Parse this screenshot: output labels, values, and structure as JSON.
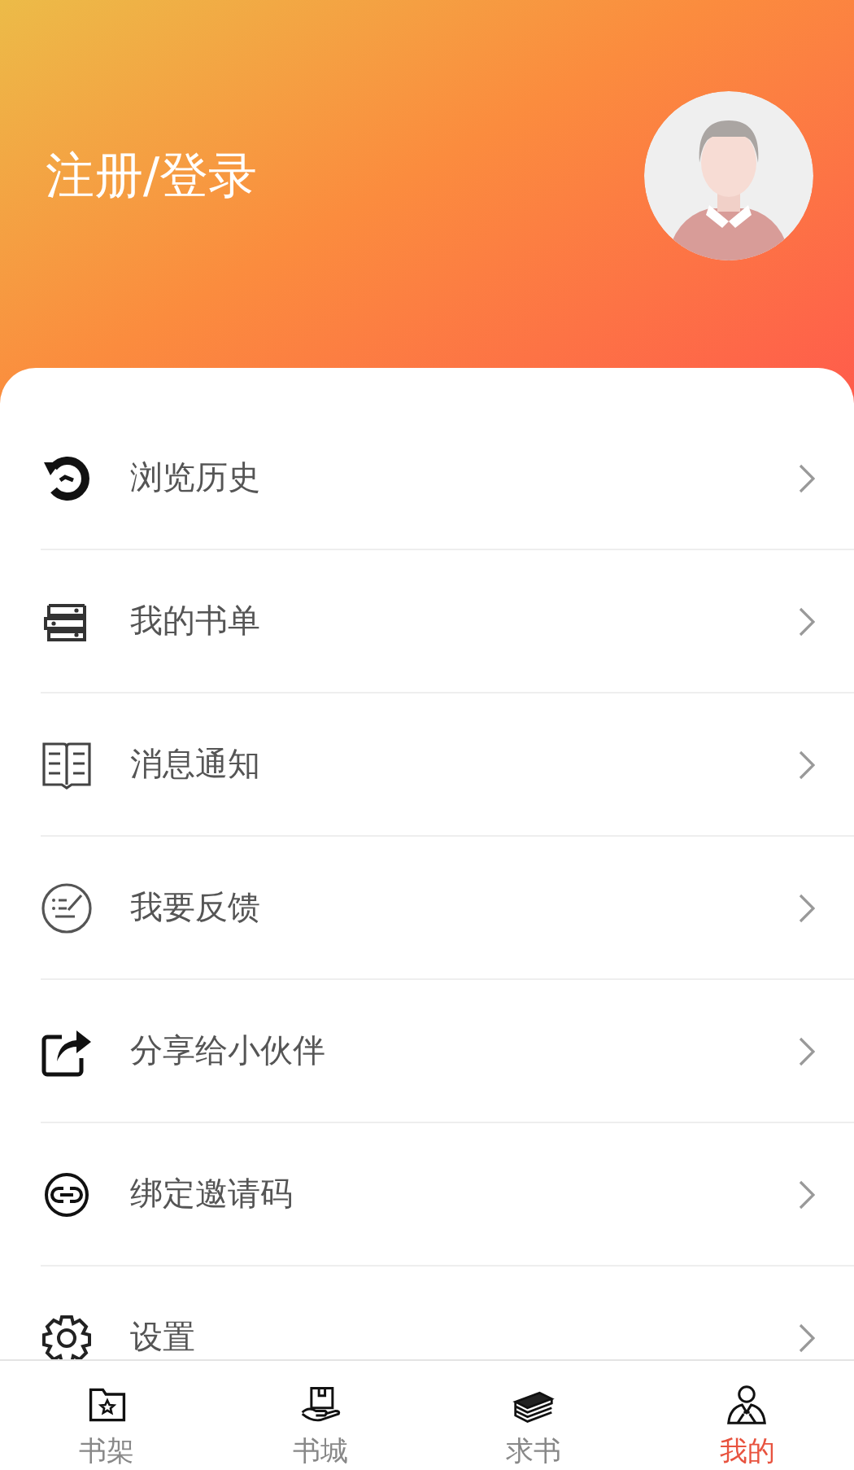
{
  "header": {
    "login_label": "注册/登录"
  },
  "menu": [
    {
      "label": "浏览历史"
    },
    {
      "label": "我的书单"
    },
    {
      "label": "消息通知"
    },
    {
      "label": "我要反馈"
    },
    {
      "label": "分享给小伙伴"
    },
    {
      "label": "绑定邀请码"
    },
    {
      "label": "设置"
    }
  ],
  "tab_bar": [
    {
      "label": "书架",
      "selected": false
    },
    {
      "label": "书城",
      "selected": false
    },
    {
      "label": "求书",
      "selected": false
    },
    {
      "label": "我的",
      "selected": true
    }
  ]
}
